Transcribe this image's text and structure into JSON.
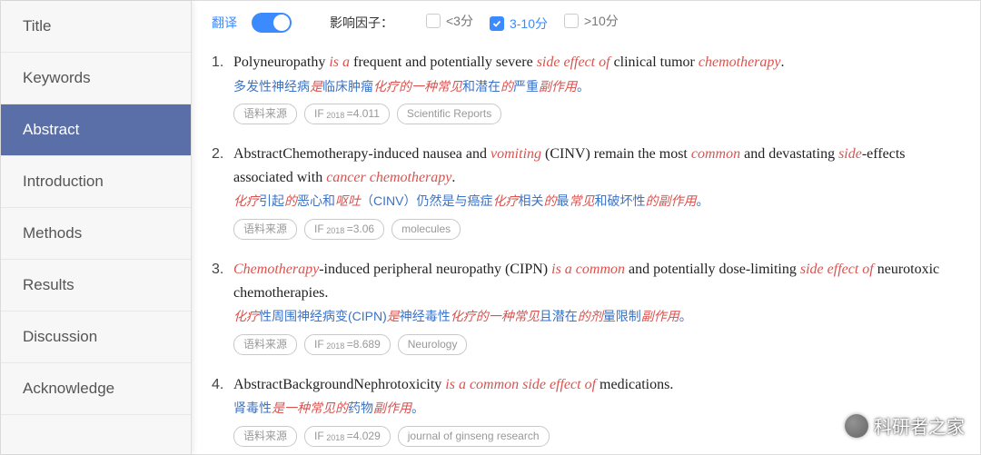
{
  "sidebar": {
    "items": [
      {
        "label": "Title"
      },
      {
        "label": "Keywords"
      },
      {
        "label": "Abstract",
        "active": true
      },
      {
        "label": "Introduction"
      },
      {
        "label": "Methods"
      },
      {
        "label": "Results"
      },
      {
        "label": "Discussion"
      },
      {
        "label": "Acknowledge"
      }
    ]
  },
  "toolbar": {
    "translate_label": "翻译",
    "translate_on": true,
    "if_label": "影响因子：",
    "filters": [
      {
        "label": "<3分",
        "checked": false
      },
      {
        "label": "3-10分",
        "checked": true
      },
      {
        "label": ">10分",
        "checked": false
      }
    ]
  },
  "tags_common": {
    "source": "语料来源"
  },
  "results": [
    {
      "en": [
        {
          "t": "Polyneuropathy "
        },
        {
          "t": "is a",
          "hl": true
        },
        {
          "t": " frequent and potentially severe "
        },
        {
          "t": "side effect of",
          "hl": true
        },
        {
          "t": " clinical tumor "
        },
        {
          "t": "chemotherapy",
          "hl": true
        },
        {
          "t": "."
        }
      ],
      "zh": [
        {
          "t": "多发性神经病"
        },
        {
          "t": "是",
          "hl": true
        },
        {
          "t": "临床肿瘤"
        },
        {
          "t": "化疗的一种常见",
          "hl": true
        },
        {
          "t": "和潜在"
        },
        {
          "t": "的",
          "hl": true
        },
        {
          "t": "严重"
        },
        {
          "t": "副作用",
          "hl": true
        },
        {
          "t": "。"
        }
      ],
      "if": "IF 2018 =4.011",
      "journal": "Scientific Reports"
    },
    {
      "en": [
        {
          "t": "AbstractChemotherapy-induced nausea and "
        },
        {
          "t": "vomiting",
          "hl": true
        },
        {
          "t": " (CINV) remain the most "
        },
        {
          "t": "common",
          "hl": true
        },
        {
          "t": " and devastating "
        },
        {
          "t": "side",
          "hl": true
        },
        {
          "t": "-effects associated with "
        },
        {
          "t": "cancer chemotherapy",
          "hl": true
        },
        {
          "t": "."
        }
      ],
      "zh": [
        {
          "t": "化疗",
          "hl": true
        },
        {
          "t": "引起"
        },
        {
          "t": "的",
          "hl": true
        },
        {
          "t": "恶心和"
        },
        {
          "t": "呕吐",
          "hl": true
        },
        {
          "t": "（CINV）仍然是与癌症"
        },
        {
          "t": "化疗",
          "hl": true
        },
        {
          "t": "相关"
        },
        {
          "t": "的",
          "hl": true
        },
        {
          "t": "最"
        },
        {
          "t": "常见",
          "hl": true
        },
        {
          "t": "和破坏性"
        },
        {
          "t": "的副作用",
          "hl": true
        },
        {
          "t": "。"
        }
      ],
      "if": "IF 2018 =3.06",
      "journal": "molecules"
    },
    {
      "en": [
        {
          "t": "Chemotherapy",
          "hl": true
        },
        {
          "t": "-induced peripheral neuropathy (CIPN) "
        },
        {
          "t": "is a common",
          "hl": true
        },
        {
          "t": " and potentially dose-limiting "
        },
        {
          "t": "side effect of",
          "hl": true
        },
        {
          "t": " neurotoxic chemotherapies."
        }
      ],
      "zh": [
        {
          "t": "化疗",
          "hl": true
        },
        {
          "t": "性周围神经病变(CIPN)"
        },
        {
          "t": "是",
          "hl": true
        },
        {
          "t": "神经毒性"
        },
        {
          "t": "化疗的一种常见",
          "hl": true
        },
        {
          "t": "且潜在"
        },
        {
          "t": "的剂",
          "hl": true
        },
        {
          "t": "量限制"
        },
        {
          "t": "副作用",
          "hl": true
        },
        {
          "t": "。"
        }
      ],
      "if": "IF 2018 =8.689",
      "journal": "Neurology"
    },
    {
      "en": [
        {
          "t": "AbstractBackgroundNephrotoxicity "
        },
        {
          "t": "is a common side effect of",
          "hl": true
        },
        {
          "t": " medications."
        }
      ],
      "zh": [
        {
          "t": "肾毒性"
        },
        {
          "t": "是一种常见的",
          "hl": true
        },
        {
          "t": "药物"
        },
        {
          "t": "副作用",
          "hl": true
        },
        {
          "t": "。"
        }
      ],
      "if": "IF 2018 =4.029",
      "journal": "journal of ginseng research"
    }
  ],
  "watermark": "科研者之家"
}
